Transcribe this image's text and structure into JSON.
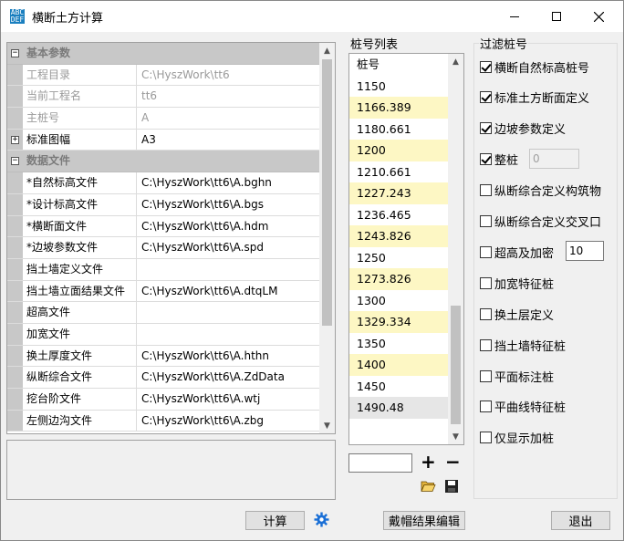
{
  "window": {
    "title": "横断土方计算",
    "icon_text": [
      "ABC",
      "DEF"
    ],
    "controls": [
      "minimize-icon",
      "maximize-icon",
      "close-icon"
    ]
  },
  "params": {
    "categories": [
      {
        "title": "基本参数",
        "rows": [
          {
            "name": "工程目录",
            "value": "C:\\HyszWork\\tt6",
            "readonly": true
          },
          {
            "name": "当前工程名",
            "value": "tt6",
            "readonly": true
          },
          {
            "name": "主桩号",
            "value": "A",
            "readonly": true
          },
          {
            "name": "标准图幅",
            "value": "A3",
            "expandable": true
          }
        ]
      },
      {
        "title": "数据文件",
        "rows": [
          {
            "name": "*自然标高文件",
            "value": "C:\\HyszWork\\tt6\\A.bghn"
          },
          {
            "name": "*设计标高文件",
            "value": "C:\\HyszWork\\tt6\\A.bgs"
          },
          {
            "name": "*横断面文件",
            "value": "C:\\HyszWork\\tt6\\A.hdm"
          },
          {
            "name": "*边坡参数文件",
            "value": "C:\\HyszWork\\tt6\\A.spd"
          },
          {
            "name": "挡土墙定义文件",
            "value": ""
          },
          {
            "name": "挡土墙立面结果文件",
            "value": "C:\\HyszWork\\tt6\\A.dtqLM"
          },
          {
            "name": "超高文件",
            "value": ""
          },
          {
            "name": "加宽文件",
            "value": ""
          },
          {
            "name": "换土厚度文件",
            "value": "C:\\HyszWork\\tt6\\A.hthn"
          },
          {
            "name": "纵断综合文件",
            "value": "C:\\HyszWork\\tt6\\A.ZdData"
          },
          {
            "name": "挖台阶文件",
            "value": "C:\\HyszWork\\tt6\\A.wtj"
          },
          {
            "name": "左侧边沟文件",
            "value": "C:\\HyszWork\\tt6\\A.zbg"
          }
        ]
      }
    ]
  },
  "pile_list": {
    "label": "桩号列表",
    "header": "桩号",
    "items": [
      {
        "value": "1150",
        "highlight": false
      },
      {
        "value": "1166.389",
        "highlight": true
      },
      {
        "value": "1180.661",
        "highlight": false
      },
      {
        "value": "1200",
        "highlight": true
      },
      {
        "value": "1210.661",
        "highlight": false
      },
      {
        "value": "1227.243",
        "highlight": true
      },
      {
        "value": "1236.465",
        "highlight": false
      },
      {
        "value": "1243.826",
        "highlight": true
      },
      {
        "value": "1250",
        "highlight": false
      },
      {
        "value": "1273.826",
        "highlight": true
      },
      {
        "value": "1300",
        "highlight": false
      },
      {
        "value": "1329.334",
        "highlight": true
      },
      {
        "value": "1350",
        "highlight": false
      },
      {
        "value": "1400",
        "highlight": true
      },
      {
        "value": "1450",
        "highlight": false
      },
      {
        "value": "1490.48",
        "highlight": false,
        "selected": true
      }
    ],
    "add_label": "+",
    "remove_label": "−",
    "input_value": ""
  },
  "filter": {
    "title": "过滤桩号",
    "items": [
      {
        "label": "横断自然标高桩号",
        "checked": true
      },
      {
        "label": "标准土方断面定义",
        "checked": true
      },
      {
        "label": "边坡参数定义",
        "checked": true
      },
      {
        "label": "整桩",
        "checked": true,
        "input": "0",
        "input_disabled": true
      },
      {
        "label": "纵断综合定义构筑物",
        "checked": false
      },
      {
        "label": "纵断综合定义交叉口",
        "checked": false
      },
      {
        "label": "超高及加密",
        "checked": false,
        "input": "10",
        "input_disabled": false
      },
      {
        "label": "加宽特征桩",
        "checked": false
      },
      {
        "label": "换土层定义",
        "checked": false
      },
      {
        "label": "挡土墙特征桩",
        "checked": false
      },
      {
        "label": "平面标注桩",
        "checked": false
      },
      {
        "label": "平曲线特征桩",
        "checked": false
      },
      {
        "label": "仅显示加桩",
        "checked": false
      }
    ]
  },
  "buttons": {
    "calc": "计算",
    "result_edit": "戴帽结果编辑",
    "exit": "退出"
  },
  "colors": {
    "highlight_row": "#fdf7c4",
    "category_bg": "#c8c8c8",
    "accent_blue": "#1a6fd6"
  }
}
